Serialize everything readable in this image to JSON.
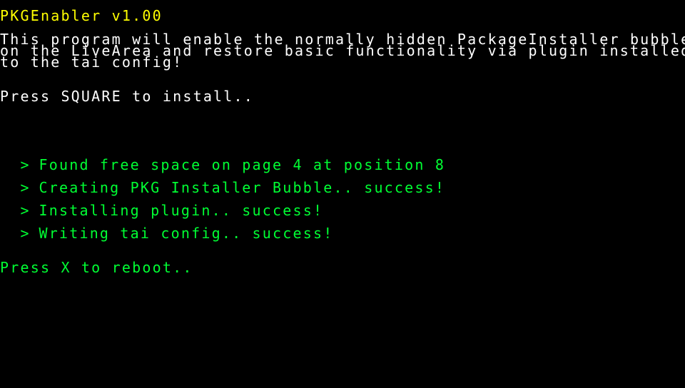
{
  "app": {
    "title": "PKGEnabler v1.00"
  },
  "intro": {
    "line1": "This program will enable the normally hidden PackageInstaller bubble",
    "line2": "on the LiveArea and restore basic functionality via plugin installed",
    "line3": "to the tai config!"
  },
  "prompt_install": "Press SQUARE to install..",
  "log": {
    "bullet": ">",
    "items": [
      "Found free space on page 4 at position 8",
      "Creating PKG Installer Bubble.. success!",
      "Installing plugin.. success!",
      "Writing tai config.. success!"
    ]
  },
  "prompt_reboot": "Press X to reboot..",
  "colors": {
    "background": "#000000",
    "title": "#ffff00",
    "text": "#ffffff",
    "success": "#00ff33"
  }
}
